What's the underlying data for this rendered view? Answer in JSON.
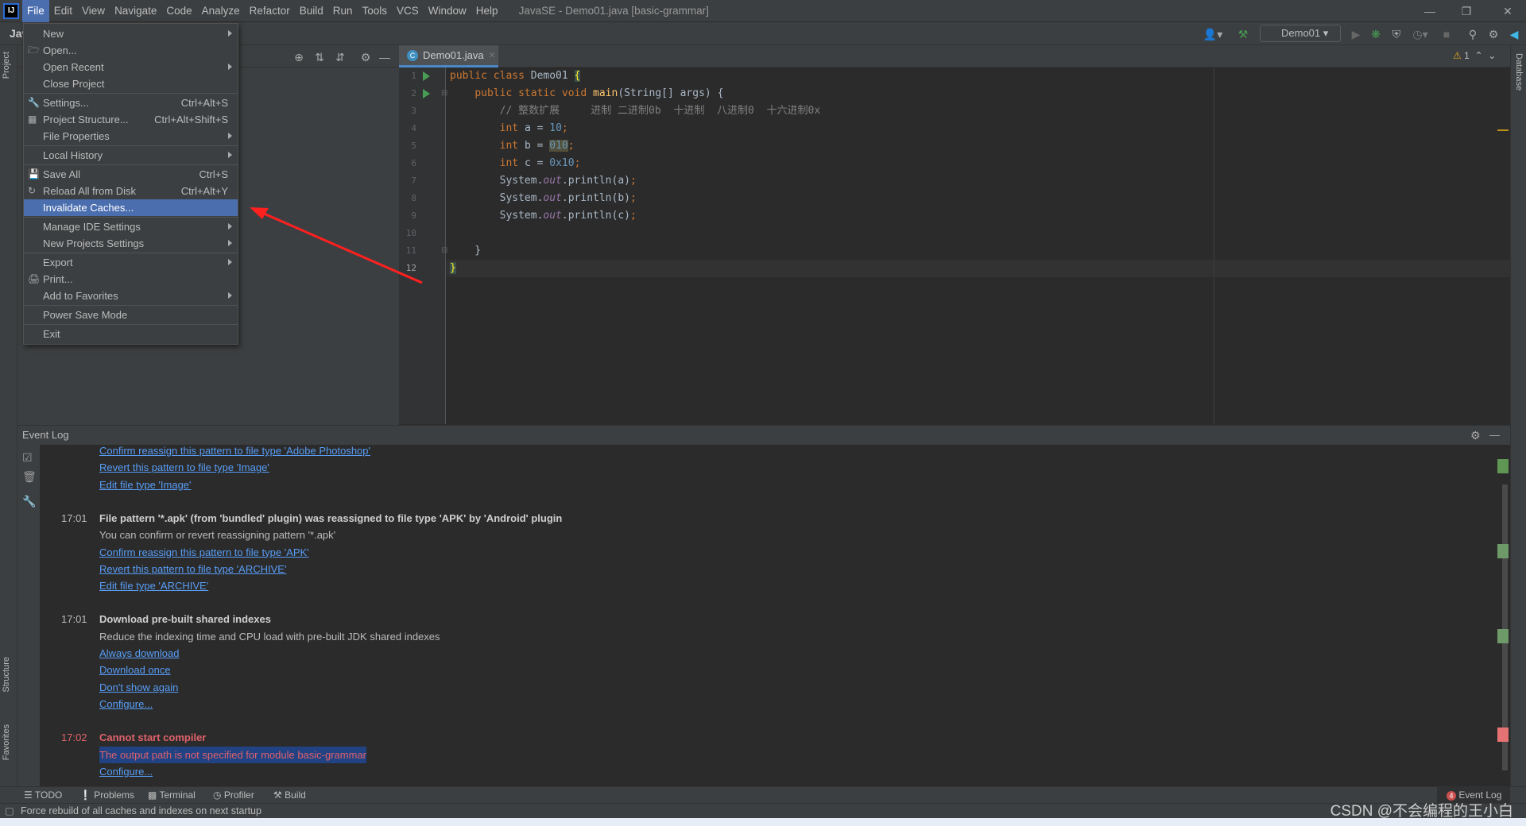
{
  "app": {
    "logo": "IJ",
    "title": "JavaSE - Demo01.java [basic-grammar]"
  },
  "menubar": [
    "File",
    "Edit",
    "View",
    "Navigate",
    "Code",
    "Analyze",
    "Refactor",
    "Build",
    "Run",
    "Tools",
    "VCS",
    "Window",
    "Help"
  ],
  "toolbar": {
    "project_label": "Jav",
    "run_config": "Demo01"
  },
  "file_menu": [
    {
      "label": "New",
      "submenu": true
    },
    {
      "label": "Open...",
      "icon": "folder-icon"
    },
    {
      "label": "Open Recent",
      "submenu": true
    },
    {
      "label": "Close Project"
    },
    {
      "sep": true
    },
    {
      "label": "Settings...",
      "shortcut": "Ctrl+Alt+S",
      "icon": "wrench-icon"
    },
    {
      "label": "Project Structure...",
      "shortcut": "Ctrl+Alt+Shift+S",
      "icon": "project-structure-icon"
    },
    {
      "label": "File Properties",
      "submenu": true
    },
    {
      "sep": true
    },
    {
      "label": "Local History",
      "submenu": true
    },
    {
      "sep": true
    },
    {
      "label": "Save All",
      "shortcut": "Ctrl+S",
      "icon": "save-icon"
    },
    {
      "label": "Reload All from Disk",
      "shortcut": "Ctrl+Alt+Y",
      "icon": "reload-icon"
    },
    {
      "label": "Invalidate Caches...",
      "highlighted": true
    },
    {
      "sep": true
    },
    {
      "label": "Manage IDE Settings",
      "submenu": true
    },
    {
      "label": "New Projects Settings",
      "submenu": true
    },
    {
      "sep": true
    },
    {
      "label": "Export",
      "submenu": true
    },
    {
      "label": "Print...",
      "icon": "print-icon"
    },
    {
      "label": "Add to Favorites",
      "submenu": true
    },
    {
      "sep": true
    },
    {
      "label": "Power Save Mode"
    },
    {
      "sep": true
    },
    {
      "label": "Exit"
    }
  ],
  "editor": {
    "tab": "Demo01.java",
    "warnings": "1",
    "lines": [
      "1",
      "2",
      "3",
      "4",
      "5",
      "6",
      "7",
      "8",
      "9",
      "10",
      "11",
      "12"
    ]
  },
  "side_labels": {
    "project": "Project",
    "structure": "Structure",
    "favorites": "Favorites",
    "database": "Database"
  },
  "event_log": {
    "title": "Event Log",
    "entries": [
      {
        "text": "Confirm reassign this pattern to file type 'Adobe Photoshop'",
        "kind": "link"
      },
      {
        "text": "Revert this pattern to file type 'Image'",
        "kind": "link"
      },
      {
        "text": "Edit file type 'Image'",
        "kind": "link"
      },
      {
        "time": "17:01",
        "text": "File pattern '*.apk' (from 'bundled' plugin) was reassigned to file type 'APK' by 'Android' plugin",
        "kind": "bold"
      },
      {
        "text": "You can confirm or revert reassigning pattern '*.apk'",
        "kind": "plain"
      },
      {
        "text": "Confirm reassign this pattern to file type 'APK'",
        "kind": "link"
      },
      {
        "text": "Revert this pattern to file type 'ARCHIVE'",
        "kind": "link"
      },
      {
        "text": "Edit file type 'ARCHIVE'",
        "kind": "link"
      },
      {
        "time": "17:01",
        "text": "Download pre-built shared indexes",
        "kind": "bold"
      },
      {
        "text": "Reduce the indexing time and CPU load with pre-built JDK shared indexes",
        "kind": "plain"
      },
      {
        "text": "Always download",
        "kind": "link"
      },
      {
        "text": "Download once",
        "kind": "link"
      },
      {
        "text": "Don't show again",
        "kind": "link"
      },
      {
        "text": "Configure...",
        "kind": "link"
      },
      {
        "time": "17:02",
        "text": "Cannot start compiler",
        "kind": "error-bold"
      },
      {
        "text": "The output path is not specified for module basic-grammar",
        "kind": "error-selected"
      },
      {
        "text": "Configure...",
        "kind": "link"
      }
    ]
  },
  "bottom_tools": [
    "TODO",
    "Problems",
    "Terminal",
    "Profiler",
    "Build"
  ],
  "event_log_button": {
    "badge": "4",
    "label": "Event Log"
  },
  "status": "Force rebuild of all caches and indexes on next startup",
  "watermark": "CSDN @不会编程的王小白",
  "colors": {
    "accent": "#4b6eaf",
    "link": "#589df6",
    "error": "#e0626b",
    "arrow": "#ff2020"
  }
}
